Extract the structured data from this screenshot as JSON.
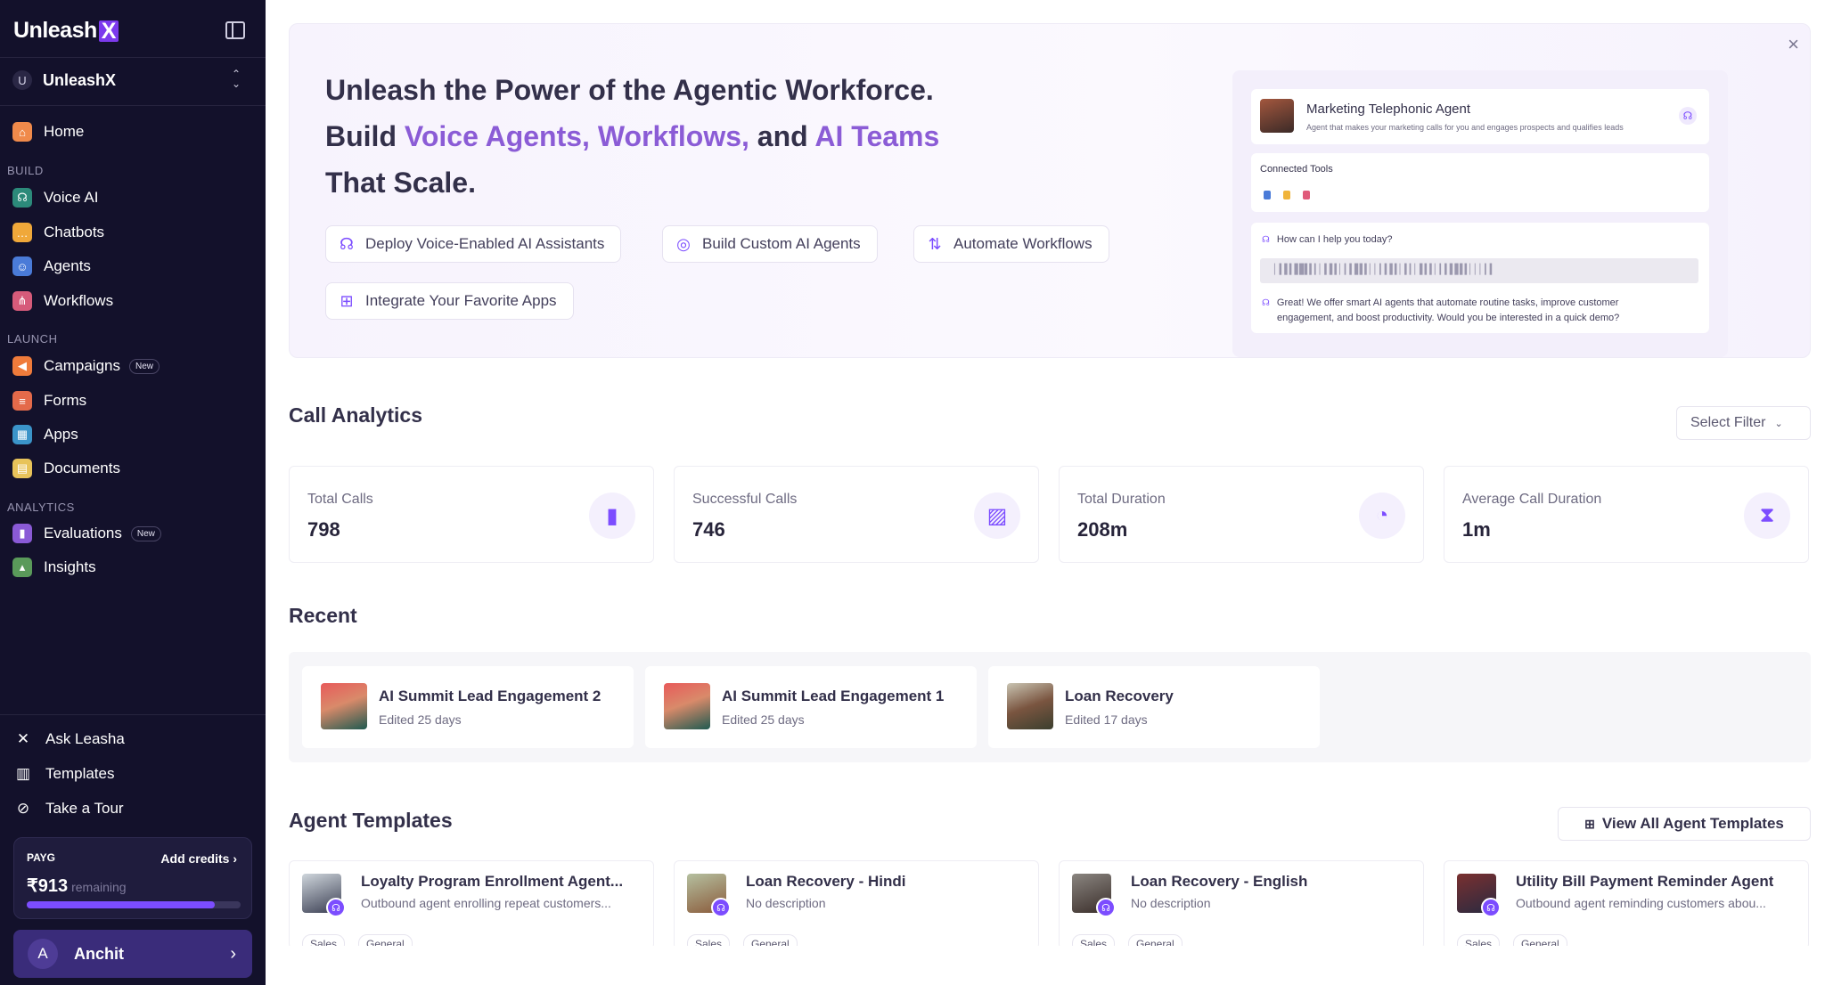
{
  "app": {
    "logo_text": "Unleash",
    "logo_x": "X",
    "workspace_initial": "U",
    "workspace_name": "UnleashX"
  },
  "sidebar": {
    "home": "Home",
    "sections": {
      "build": "BUILD",
      "launch": "LAUNCH",
      "analytics": "ANALYTICS"
    },
    "build_items": [
      "Voice AI",
      "Chatbots",
      "Agents",
      "Workflows"
    ],
    "launch_items": [
      "Campaigns",
      "Forms",
      "Apps",
      "Documents"
    ],
    "analytics_items": [
      "Evaluations",
      "Insights"
    ],
    "new_badge": "New",
    "bottom_items": [
      "Ask Leasha",
      "Templates",
      "Take a Tour"
    ],
    "payg": {
      "label": "PAYG",
      "add_credits": "Add credits",
      "amount": "₹913",
      "remaining": "remaining",
      "progress": 0.88
    },
    "user": {
      "initial": "A",
      "name": "Anchit"
    }
  },
  "hero": {
    "line1": "Unleash the Power of the Agentic Workforce.",
    "line2_pre": "Build",
    "line2_h1": "Voice Agents, Workflows,",
    "line2_mid": "and",
    "line2_h2": "AI Teams",
    "line3": "That Scale.",
    "chips": [
      "Deploy Voice-Enabled AI Assistants",
      "Build Custom AI Agents",
      "Automate Workflows",
      "Integrate Your Favorite Apps"
    ],
    "preview": {
      "agent_title": "Marketing Telephonic Agent",
      "agent_sub": "Agent that makes your marketing calls for you and engages prospects and qualifies leads",
      "connected_tools": "Connected Tools",
      "question": "How can I help you today?",
      "answer_1": "Great! We offer smart AI agents that automate routine tasks, improve customer",
      "answer_2": "engagement, and boost productivity. Would you be interested in a quick demo?"
    }
  },
  "analytics": {
    "title": "Call Analytics",
    "filter": "Select Filter",
    "stats": [
      {
        "label": "Total Calls",
        "value": "798"
      },
      {
        "label": "Successful Calls",
        "value": "746"
      },
      {
        "label": "Total Duration",
        "value": "208m"
      },
      {
        "label": "Average Call Duration",
        "value": "1m"
      }
    ]
  },
  "recent": {
    "title": "Recent",
    "items": [
      {
        "title": "AI Summit Lead Engagement 2",
        "sub": "Edited 25 days"
      },
      {
        "title": "AI Summit Lead Engagement 1",
        "sub": "Edited 25 days"
      },
      {
        "title": "Loan Recovery",
        "sub": "Edited 17 days"
      }
    ]
  },
  "templates": {
    "title": "Agent Templates",
    "view_all": "View All Agent Templates",
    "items": [
      {
        "title": "Loyalty Program Enrollment Agent...",
        "sub": "Outbound agent enrolling repeat customers...",
        "tags": [
          "Sales",
          "General"
        ]
      },
      {
        "title": "Loan Recovery - Hindi",
        "sub": "No description",
        "tags": [
          "Sales",
          "General"
        ]
      },
      {
        "title": "Loan Recovery - English",
        "sub": "No description",
        "tags": [
          "Sales",
          "General"
        ]
      },
      {
        "title": "Utility Bill Payment Reminder Agent",
        "sub": "Outbound agent reminding customers abou...",
        "tags": [
          "Sales",
          "General"
        ]
      }
    ]
  },
  "colors": {
    "accent": "#7c4dff",
    "sidebar_bg": "#13112b",
    "highlight": "#8b5cd6"
  }
}
